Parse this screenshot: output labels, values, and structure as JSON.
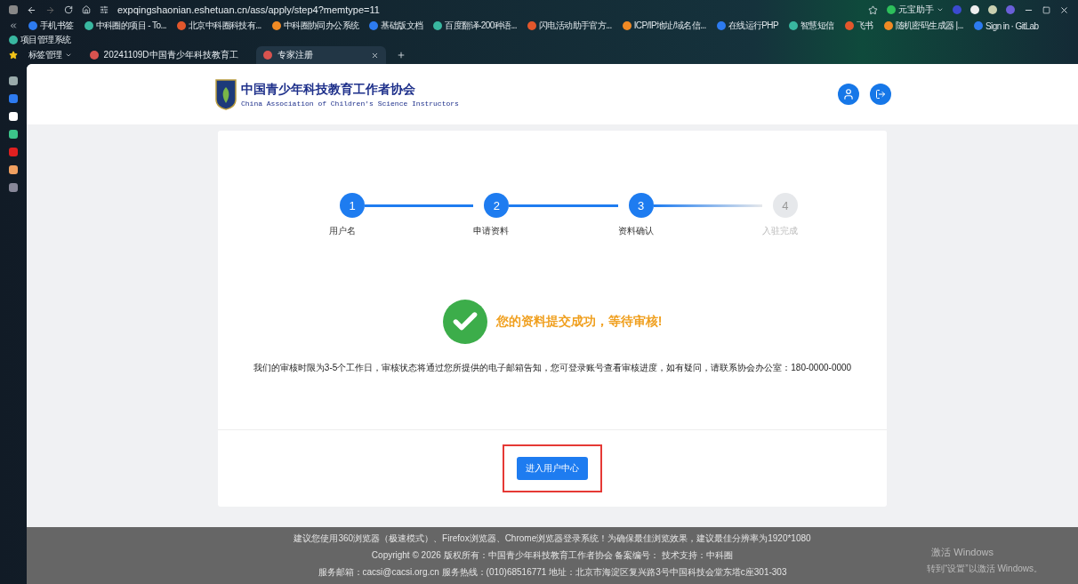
{
  "browser": {
    "url": "expqingshaonian.eshetuan.cn/ass/apply/step4?memtype=11",
    "extension_label": "元宝助手",
    "bookmarks": [
      "手机书签",
      "中科圈的项目 - To...",
      "北京中科圈科技有...",
      "中科圈协同办公系统",
      "基础版文档",
      "百度翻译-200种语...",
      "闪电活动助手官方...",
      "ICP/IP地址/域名信...",
      "在线运行PHP",
      "智慧短信",
      "飞书",
      "随机密码生成器 |...",
      "Sign in · GitLab",
      "项目管理系统"
    ],
    "tab_group": "标签管理",
    "tabs": [
      {
        "label": "20241109D中国青少年科技教育工",
        "selected": false
      },
      {
        "label": "专家注册",
        "selected": true
      }
    ]
  },
  "header": {
    "org_name": "中国青少年科技教育工作者协会",
    "org_name_en": "China Association of Children's Science Instructors"
  },
  "steps": [
    {
      "number": "1",
      "label": "用户名",
      "done": true
    },
    {
      "number": "2",
      "label": "申请资料",
      "done": true
    },
    {
      "number": "3",
      "label": "资料确认",
      "done": true
    },
    {
      "number": "4",
      "label": "入驻完成",
      "done": false
    }
  ],
  "result": {
    "title": "您的资料提交成功，等待审核!",
    "message": "我们的审核时限为3-5个工作日，审核状态将通过您所提供的电子邮箱告知，您可登录账号查看审核进度，如有疑问，请联系协会办公室：180-0000-0000"
  },
  "button": "进入用户中心",
  "footer": [
    "建议您使用360浏览器（极速模式）、Firefox浏览器、Chrome浏览器登录系统！为确保最佳浏览效果，建议最佳分辨率为1920*1080",
    "Copyright © 2026 版权所有：中国青少年科技教育工作者协会 备案编号： 技术支持：中科圈",
    "服务邮箱：cacsi@cacsi.org.cn 服务热线：(010)68516771 地址：北京市海淀区复兴路3号中国科技会堂东塔c座301-303"
  ],
  "os_notice": {
    "title": "激活 Windows",
    "hint": "转到“设置”以激活 Windows。"
  }
}
